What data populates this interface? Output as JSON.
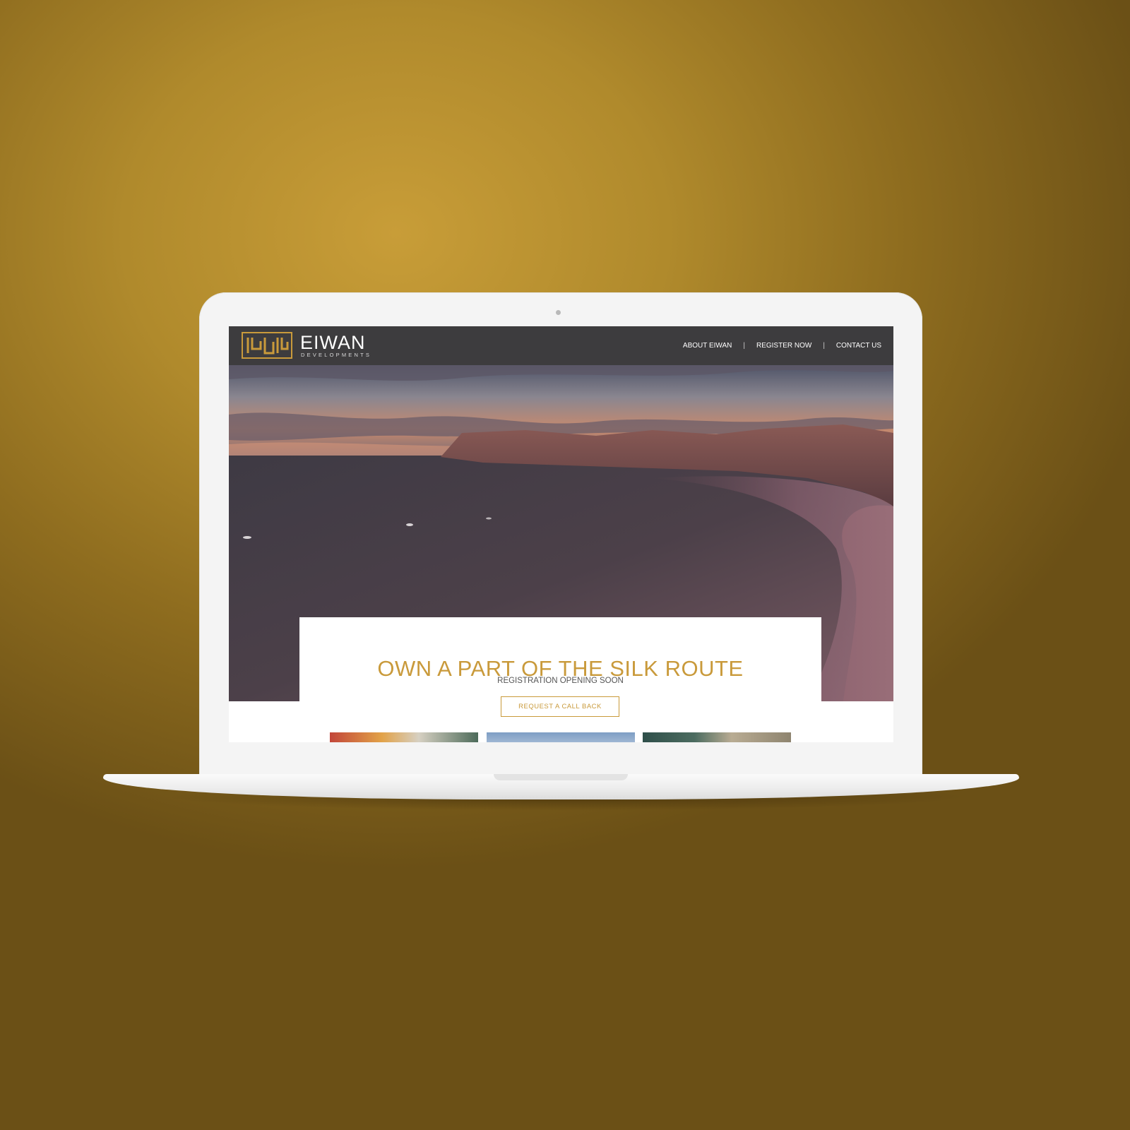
{
  "colors": {
    "background": "#b08a2c",
    "header": "#3d3c3e",
    "accent_gold": "#c99a3b"
  },
  "site": {
    "logo": {
      "name": "EIWAN",
      "tagline": "DEVELOPMENTS"
    },
    "nav": {
      "items": [
        {
          "label": "ABOUT EIWAN"
        },
        {
          "label": "REGISTER NOW"
        },
        {
          "label": "CONTACT US"
        }
      ],
      "separator": "|"
    },
    "hero": {
      "image": "coastal-cliffs-sunset-photo"
    },
    "cta": {
      "title": "OWN A PART OF THE SILK ROUTE",
      "subtitle": "REGISTRATION OPENING SOON",
      "button": "REQUEST A CALL BACK"
    },
    "thumbnails": [
      "flag-thumbnail",
      "sky-thumbnail",
      "coast-thumbnail"
    ]
  }
}
